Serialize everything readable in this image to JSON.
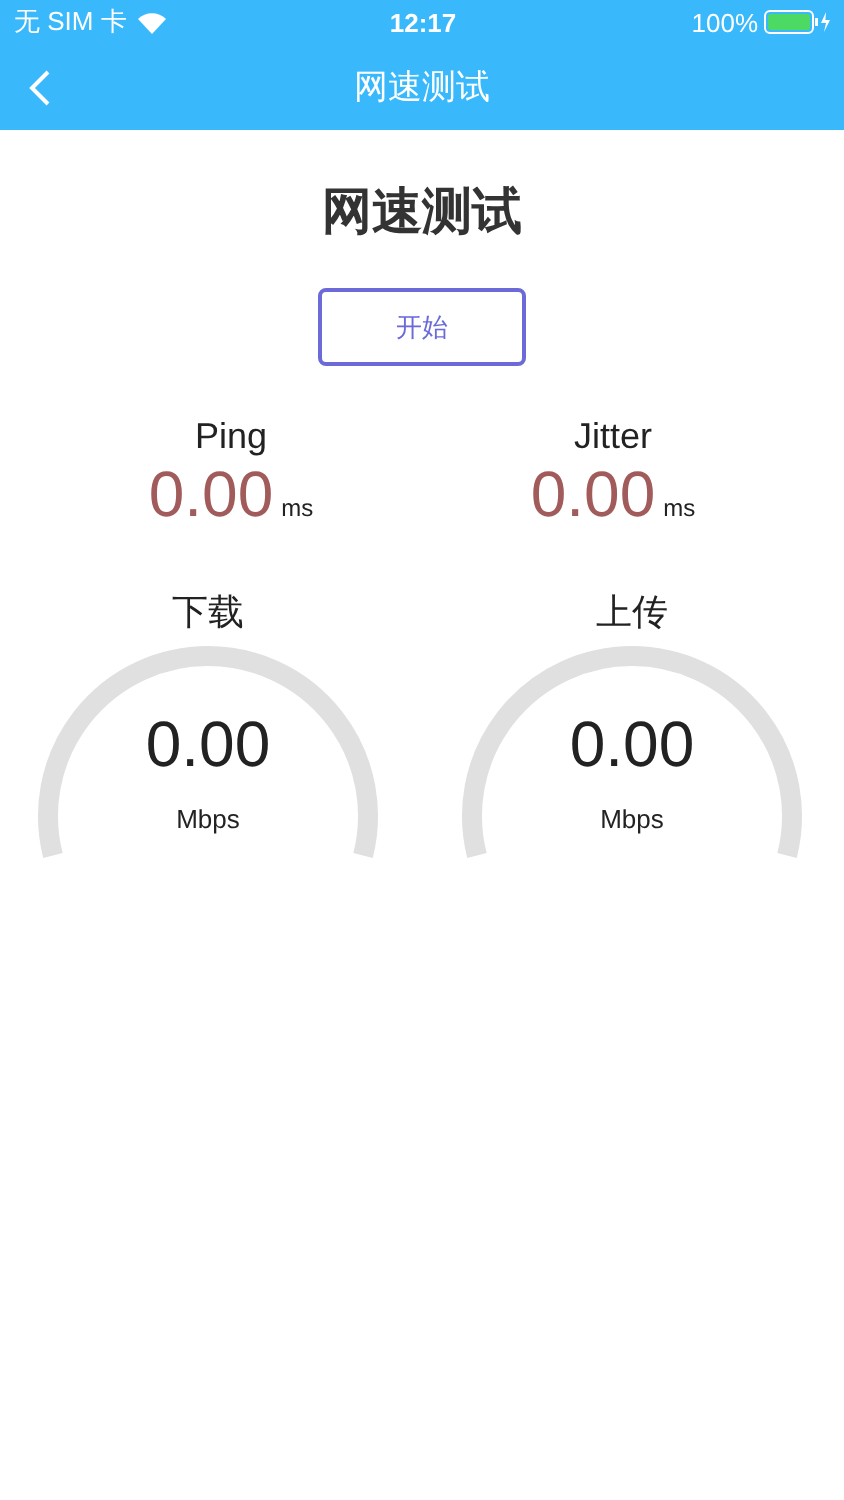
{
  "status_bar": {
    "carrier": "无 SIM 卡",
    "time": "12:17",
    "battery": "100%"
  },
  "nav_bar": {
    "title": "网速测试"
  },
  "heading": "网速测试",
  "start_button": "开始",
  "metrics": [
    {
      "label": "Ping",
      "value": "0.00",
      "unit": "ms"
    },
    {
      "label": "Jitter",
      "value": "0.00",
      "unit": "ms"
    }
  ],
  "gauges": [
    {
      "label": "下载",
      "value": "0.00",
      "unit": "Mbps"
    },
    {
      "label": "上传",
      "value": "0.00",
      "unit": "Mbps"
    }
  ]
}
